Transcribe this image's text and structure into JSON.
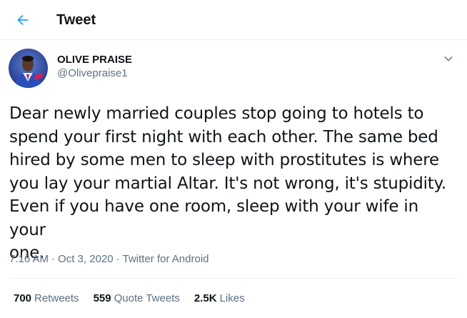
{
  "header": {
    "back_icon": "arrow-left-icon",
    "title": "Tweet",
    "accent_color": "#1da1f2"
  },
  "author": {
    "display_name": "OLIVE PRAISE",
    "handle": "@Olivepraise1",
    "menu_icon": "chevron-down-icon"
  },
  "tweet": {
    "text": "Dear newly married couples stop going to hotels to\nspend your first night with each other. The same bed\nhired by some men to sleep with prostitutes is where\nyou lay your martial Altar. It's not wrong, it's stupidity.\nEven if you have one room, sleep with your wife in your\none.",
    "time": "7:16 AM",
    "separator": "·",
    "date": "Oct 3, 2020",
    "source": "Twitter for Android"
  },
  "stats": {
    "retweets_count": "700",
    "retweets_label": "Retweets",
    "quote_count": "559",
    "quote_label": "Quote Tweets",
    "likes_count": "2.5K",
    "likes_label": "Likes"
  }
}
